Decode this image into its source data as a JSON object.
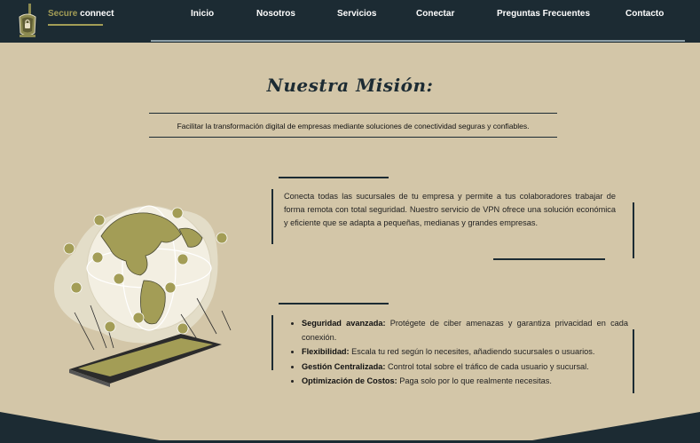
{
  "brand": {
    "part1": "Secure",
    "part2": "connect"
  },
  "nav": {
    "items": [
      "Inicio",
      "Nosotros",
      "Servicios",
      "Conectar",
      "Preguntas Frecuentes",
      "Contacto"
    ]
  },
  "mission": {
    "title": "Nuestra Misión:",
    "tagline": "Facilitar la transformación digital de empresas mediante soluciones de conectividad seguras y confiables."
  },
  "service": {
    "description": "Conecta todas las sucursales de tu empresa y permite a tus colaboradores trabajar de forma remota con total seguridad. Nuestro servicio de VPN ofrece una solución económica y eficiente que se adapta a pequeñas, medianas y grandes empresas."
  },
  "features": [
    {
      "title": "Seguridad avanzada:",
      "text": "Protégete de ciber amenazas y garantiza privacidad en cada conexión."
    },
    {
      "title": "Flexibilidad:",
      "text": "Escala tu red según lo necesites, añadiendo sucursales o usuarios."
    },
    {
      "title": "Gestión Centralizada:",
      "text": "Control total sobre el tráfico de cada usuario y sucursal."
    },
    {
      "title": "Optimización de Costos:",
      "text": "Paga solo por lo que realmente necesitas."
    }
  ],
  "colors": {
    "nav_bg": "#1c2b33",
    "accent": "#a39d56",
    "page_bg": "#d3c6a8"
  },
  "icons": [
    "mate-cup-logo-icon",
    "globe-illustration",
    "tablet-icon",
    "user-icon"
  ]
}
